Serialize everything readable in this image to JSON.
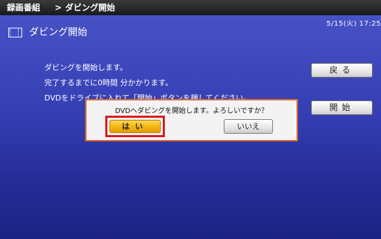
{
  "breadcrumb": {
    "parent": "録画番組",
    "separator": ">",
    "current": "ダビング開始"
  },
  "status": {
    "datetime": "5/15(火) 17:25"
  },
  "header": {
    "title": "ダビング開始",
    "icon": "film-icon"
  },
  "main": {
    "messages": [
      "ダビングを開始します。",
      "完了するまでに0時間 分かかります。",
      "DVDをドライブに入れて「開始」ボタンを押してください。"
    ]
  },
  "buttons": {
    "back_label": "戻る",
    "start_label": "開始"
  },
  "dialog": {
    "message": "DVDへダビングを開始します。よろしいですか？",
    "yes_label": "はい",
    "no_label": "いいえ"
  },
  "colors": {
    "background": "#3640b5",
    "dialog_border": "#e8702a",
    "highlight": "#e0151a",
    "yes_button": "#f2b411"
  }
}
